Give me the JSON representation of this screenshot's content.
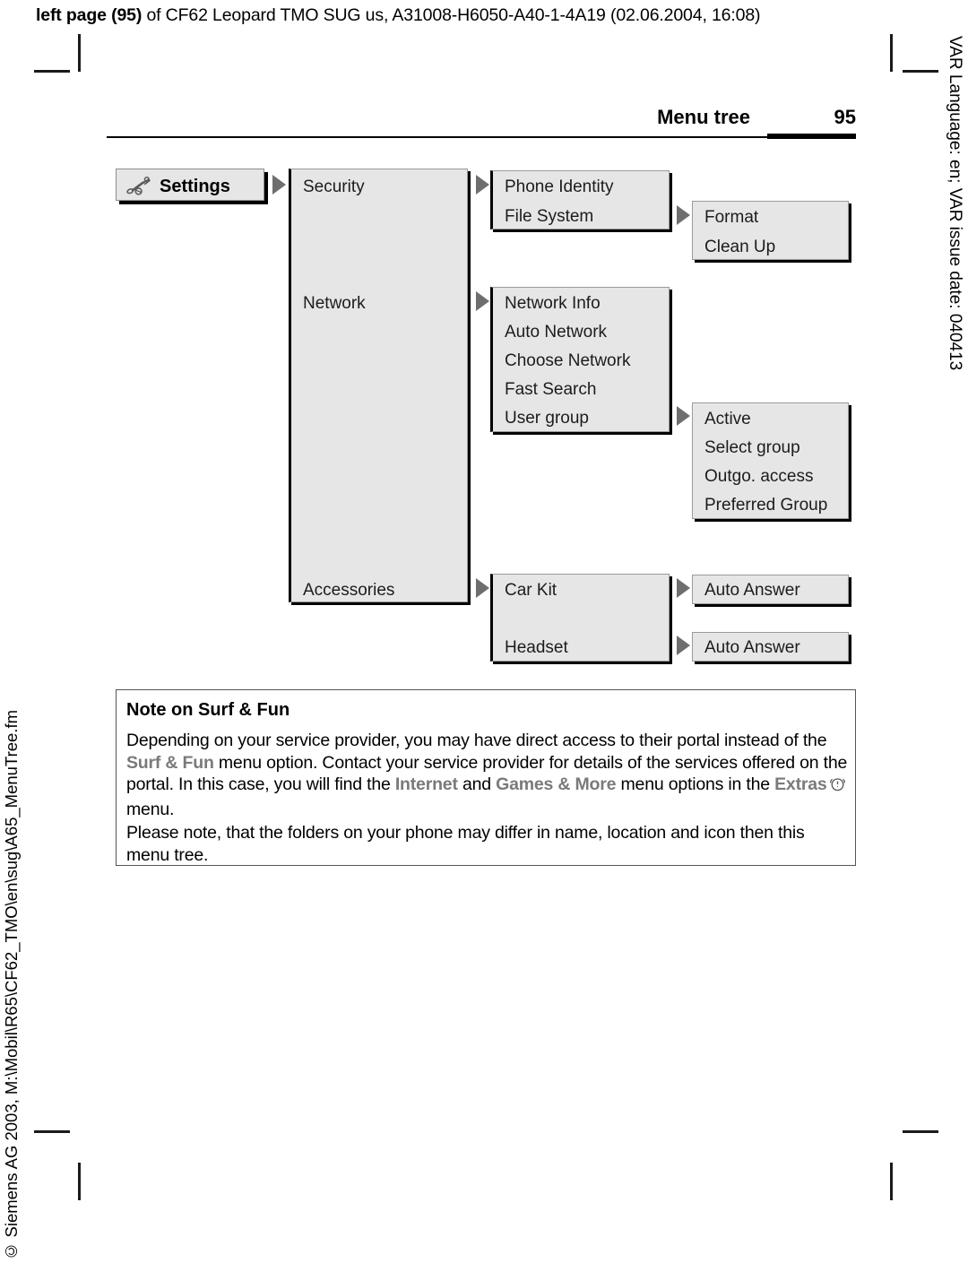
{
  "print_header": {
    "bold_prefix": "left page (95)",
    "rest": " of CF62 Leopard TMO SUG us, A31008-H6050-A40-1-4A19 (02.06.2004, 16:08)"
  },
  "side_text": {
    "right": "VAR Language: en; VAR issue date: 040413",
    "left": "© Siemens AG 2003, M:\\Mobil\\R65\\CF62_TMO\\en\\sug\\A65_MenuTree.fm"
  },
  "page_head": {
    "title": "Menu tree",
    "page_number": "95"
  },
  "tree": {
    "root": {
      "label": "Settings",
      "icon": "wrench-icon"
    },
    "level1": [
      {
        "label": "Security"
      },
      {
        "label": "Network"
      },
      {
        "label": "Accessories"
      }
    ],
    "level2_security": [
      {
        "label": "Phone Identity"
      },
      {
        "label": "File System"
      }
    ],
    "level2_network": [
      {
        "label": "Network Info"
      },
      {
        "label": "Auto Network"
      },
      {
        "label": "Choose Network"
      },
      {
        "label": "Fast Search"
      },
      {
        "label": "User group"
      }
    ],
    "level2_accessories": [
      {
        "label": "Car Kit"
      },
      {
        "label": "Headset"
      }
    ],
    "level3_filesystem": [
      {
        "label": "Format"
      },
      {
        "label": "Clean Up"
      }
    ],
    "level3_usergroup": [
      {
        "label": "Active"
      },
      {
        "label": "Select group"
      },
      {
        "label": "Outgo. access"
      },
      {
        "label": "Preferred Group"
      }
    ],
    "level3_carkit": [
      {
        "label": "Auto Answer"
      }
    ],
    "level3_headset": [
      {
        "label": "Auto Answer"
      }
    ]
  },
  "note": {
    "title": "Note on Surf & Fun",
    "p1_a": "Depending on your service provider, you may have direct access to their portal instead of the ",
    "p1_kw1": "Surf & Fun",
    "p1_b": " menu option. Contact your service provider for details of the services offered on the portal. In this case, you will find the ",
    "p1_kw2": "Internet",
    "p1_c": " and ",
    "p1_kw3": "Games & More",
    "p1_d": " menu options in the ",
    "p1_kw4": "Extras",
    "p1_icon": "alarm-clock-icon",
    "p1_e": " menu.",
    "p2": "Please note, that the folders on your phone may differ in name, location and icon then this menu tree."
  },
  "colors": {
    "box_fill": "#e6e6e6",
    "arrow": "#6e6e6e",
    "keyword": "#7a7a7a"
  }
}
